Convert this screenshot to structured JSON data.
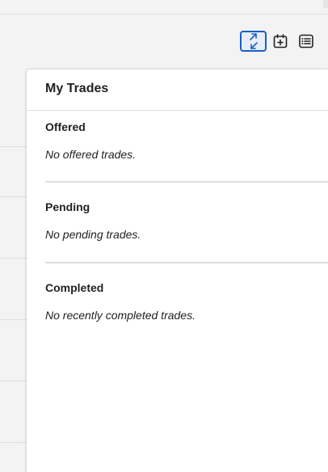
{
  "toolbar": {
    "buttons": [
      {
        "icon": "trade-arrows-icon",
        "active": true
      },
      {
        "icon": "calendar-add-icon",
        "active": false
      },
      {
        "icon": "list-icon",
        "active": false
      }
    ]
  },
  "colors": {
    "accent": "#1c5fbd",
    "panel_bg": "#ffffff",
    "page_bg": "#f3f3f3",
    "divider": "#dedede"
  },
  "panel": {
    "title": "My Trades",
    "sections": [
      {
        "heading": "Offered",
        "empty_text": "No offered trades."
      },
      {
        "heading": "Pending",
        "empty_text": "No pending trades."
      },
      {
        "heading": "Completed",
        "empty_text": "No recently completed trades."
      }
    ]
  }
}
